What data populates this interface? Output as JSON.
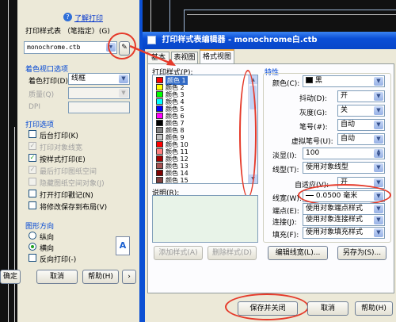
{
  "bg_window": {
    "help_link": "了解打印",
    "plot_style_label": "打印样式表 （笔指定）(G)",
    "plot_style_value": "monochrome.ctb",
    "viewport_group": "着色视口选项",
    "shade_plot_label": "着色打印(D)",
    "shade_plot_value": "线框",
    "quality_label": "质量(Q)",
    "dpi_label": "DPI",
    "plot_options_group": "打印选项",
    "options": [
      {
        "label": "后台打印(K)",
        "checked": false,
        "disabled": false
      },
      {
        "label": "打印对象线宽",
        "checked": true,
        "disabled": true
      },
      {
        "label": "按样式打印(E)",
        "checked": true,
        "disabled": false
      },
      {
        "label": "最后打印图纸空间",
        "checked": true,
        "disabled": true
      },
      {
        "label": "隐藏图纸空间对象(J)",
        "checked": false,
        "disabled": true
      },
      {
        "label": "打开打印戳记(N)",
        "checked": false,
        "disabled": false
      },
      {
        "label": "将修改保存到布局(V)",
        "checked": false,
        "disabled": false
      }
    ],
    "orientation_group": "图形方向",
    "portrait": "纵向",
    "landscape": "横向",
    "reverse": "反向打印(-)",
    "orientation_icon": "A",
    "ok": "确定",
    "cancel": "取消",
    "help": "帮助(H)",
    "help_arrow": "›"
  },
  "editor": {
    "title": "打印样式表编辑器 - monochrome白.ctb",
    "tabs": [
      "基本",
      "表视图",
      "格式视图"
    ],
    "styles_label": "打印样式(P):",
    "styles": [
      {
        "name": "颜色 1",
        "color": "#ff0000"
      },
      {
        "name": "颜色 2",
        "color": "#ffff00"
      },
      {
        "name": "颜色 3",
        "color": "#00ff00"
      },
      {
        "name": "颜色 4",
        "color": "#00ffff"
      },
      {
        "name": "颜色 5",
        "color": "#0000ff"
      },
      {
        "name": "颜色 6",
        "color": "#ff00ff"
      },
      {
        "name": "颜色 7",
        "color": "#000000"
      },
      {
        "name": "颜色 8",
        "color": "#808080"
      },
      {
        "name": "颜色 9",
        "color": "#c0c0c0"
      },
      {
        "name": "颜色 10",
        "color": "#ff0000"
      },
      {
        "name": "颜色 11",
        "color": "#ff7f7f"
      },
      {
        "name": "颜色 12",
        "color": "#a50000"
      },
      {
        "name": "颜色 13",
        "color": "#a55252"
      },
      {
        "name": "颜色 14",
        "color": "#7f0000"
      },
      {
        "name": "颜色 15",
        "color": "#7f3f3f"
      }
    ],
    "description_label": "说明(R):",
    "add_style": "添加样式(A)",
    "delete_style": "删除样式(D)",
    "properties_group": "特性",
    "color_label": "颜色(C):",
    "color_value": "黑",
    "dither_label": "抖动(D):",
    "dither_value": "开",
    "grayscale_label": "灰度(G):",
    "grayscale_value": "关",
    "pen_label": "笔号(#):",
    "pen_value": "自动",
    "vpen_label": "虚拟笔号(U):",
    "vpen_value": "自动",
    "screening_label": "淡显(I):",
    "screening_value": "100",
    "linetype_label": "线型(T):",
    "linetype_value": "使用对象线型",
    "adaptive_label": "自适应(V):",
    "adaptive_value": "开",
    "lineweight_label": "线宽(W):",
    "lineweight_value": "0.0500 毫米",
    "endstyle_label": "端点(E):",
    "endstyle_value": "使用对象端点样式",
    "joinstyle_label": "连接(J):",
    "joinstyle_value": "使用对象连接样式",
    "fill_label": "填充(F):",
    "fill_value": "使用对象填充样式",
    "edit_lineweights": "编辑线宽(L)...",
    "save_as": "另存为(S)...",
    "save_close": "保存并关闭",
    "cancel": "取消",
    "help": "帮助(H)"
  }
}
